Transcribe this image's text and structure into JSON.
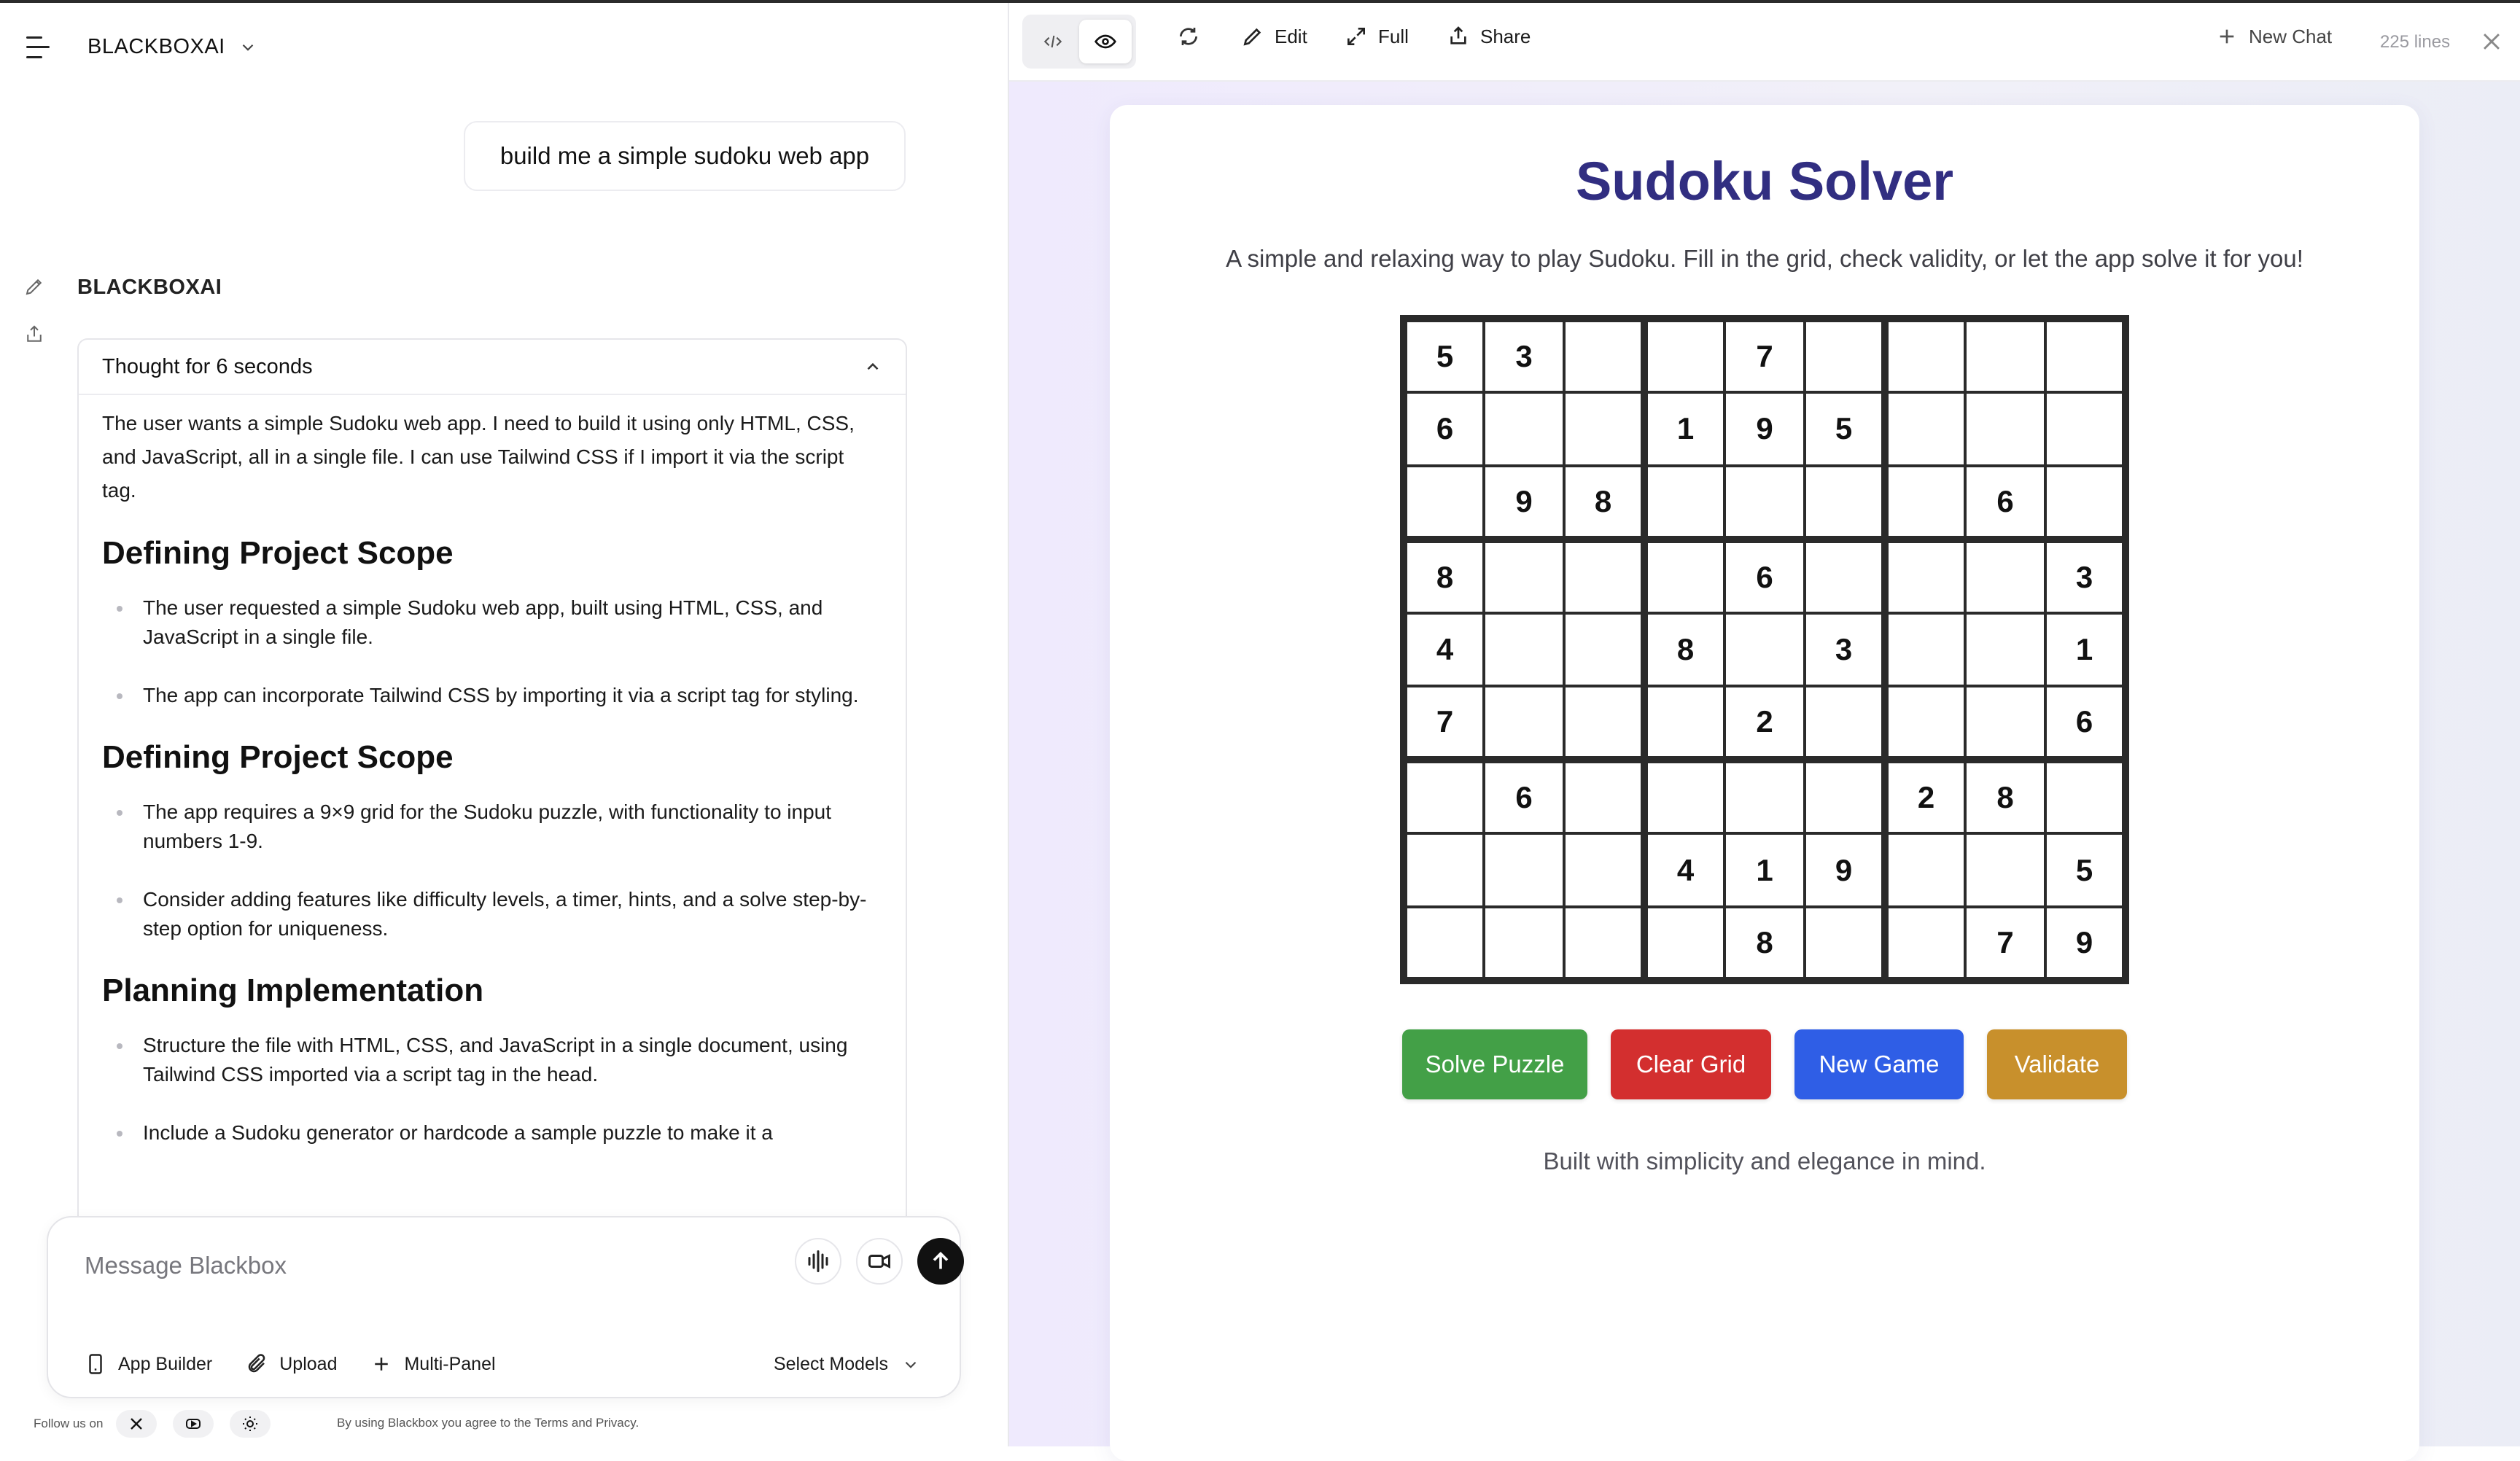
{
  "header": {
    "brand": "BLACKBOXAI"
  },
  "chat": {
    "user_message": "build me a simple sudoku web app",
    "assistant_name": "BLACKBOXAI",
    "thought_title": "Thought for 6 seconds",
    "thought_intro": "The user wants a simple Sudoku web app. I need to build it using only HTML, CSS, and JavaScript, all in a single file. I can use Tailwind CSS if I import it via the script tag.",
    "sections": [
      {
        "heading": "Defining Project Scope",
        "bullets": [
          "The user requested a simple Sudoku web app, built using HTML, CSS, and JavaScript in a single file.",
          "The app can incorporate Tailwind CSS by importing it via a script tag for styling."
        ]
      },
      {
        "heading": "Defining Project Scope",
        "bullets": [
          "The app requires a 9×9 grid for the Sudoku puzzle, with functionality to input numbers 1-9.",
          "Consider adding features like difficulty levels, a timer, hints, and a solve step-by-step option for uniqueness."
        ]
      },
      {
        "heading": "Planning Implementation",
        "bullets": [
          "Structure the file with HTML, CSS, and JavaScript in a single document, using Tailwind CSS imported via a script tag in the head.",
          "Include a Sudoku generator or hardcode a sample puzzle to make it a"
        ]
      }
    ]
  },
  "composer": {
    "placeholder": "Message Blackbox",
    "tools": {
      "app_builder": "App Builder",
      "upload": "Upload",
      "multi_panel": "Multi-Panel"
    },
    "select_models": "Select Models"
  },
  "footer": {
    "follow": "Follow us on",
    "terms": "By using Blackbox you agree to the Terms and Privacy."
  },
  "preview_toolbar": {
    "edit": "Edit",
    "full": "Full",
    "share": "Share",
    "new_chat": "New Chat",
    "lines": "225 lines"
  },
  "app": {
    "title": "Sudoku Solver",
    "subtitle": "A simple and relaxing way to play Sudoku. Fill in the grid, check validity, or let the app solve it for you!",
    "grid": [
      [
        5,
        3,
        0,
        0,
        7,
        0,
        0,
        0,
        0
      ],
      [
        6,
        0,
        0,
        1,
        9,
        5,
        0,
        0,
        0
      ],
      [
        0,
        9,
        8,
        0,
        0,
        0,
        0,
        6,
        0
      ],
      [
        8,
        0,
        0,
        0,
        6,
        0,
        0,
        0,
        3
      ],
      [
        4,
        0,
        0,
        8,
        0,
        3,
        0,
        0,
        1
      ],
      [
        7,
        0,
        0,
        0,
        2,
        0,
        0,
        0,
        6
      ],
      [
        0,
        6,
        0,
        0,
        0,
        0,
        2,
        8,
        0
      ],
      [
        0,
        0,
        0,
        4,
        1,
        9,
        0,
        0,
        5
      ],
      [
        0,
        0,
        0,
        0,
        8,
        0,
        0,
        7,
        9
      ]
    ],
    "buttons": [
      {
        "label": "Solve Puzzle",
        "color": "#43a047",
        "name": "solve-puzzle-button"
      },
      {
        "label": "Clear Grid",
        "color": "#d32f2f",
        "name": "clear-grid-button"
      },
      {
        "label": "New Game",
        "color": "#2f5ee6",
        "name": "new-game-button"
      },
      {
        "label": "Validate",
        "color": "#c8902c",
        "name": "validate-button"
      }
    ],
    "footer": "Built with simplicity and elegance in mind."
  },
  "colors": {
    "title": "#312e81",
    "panel_bg": "#efeafd"
  }
}
